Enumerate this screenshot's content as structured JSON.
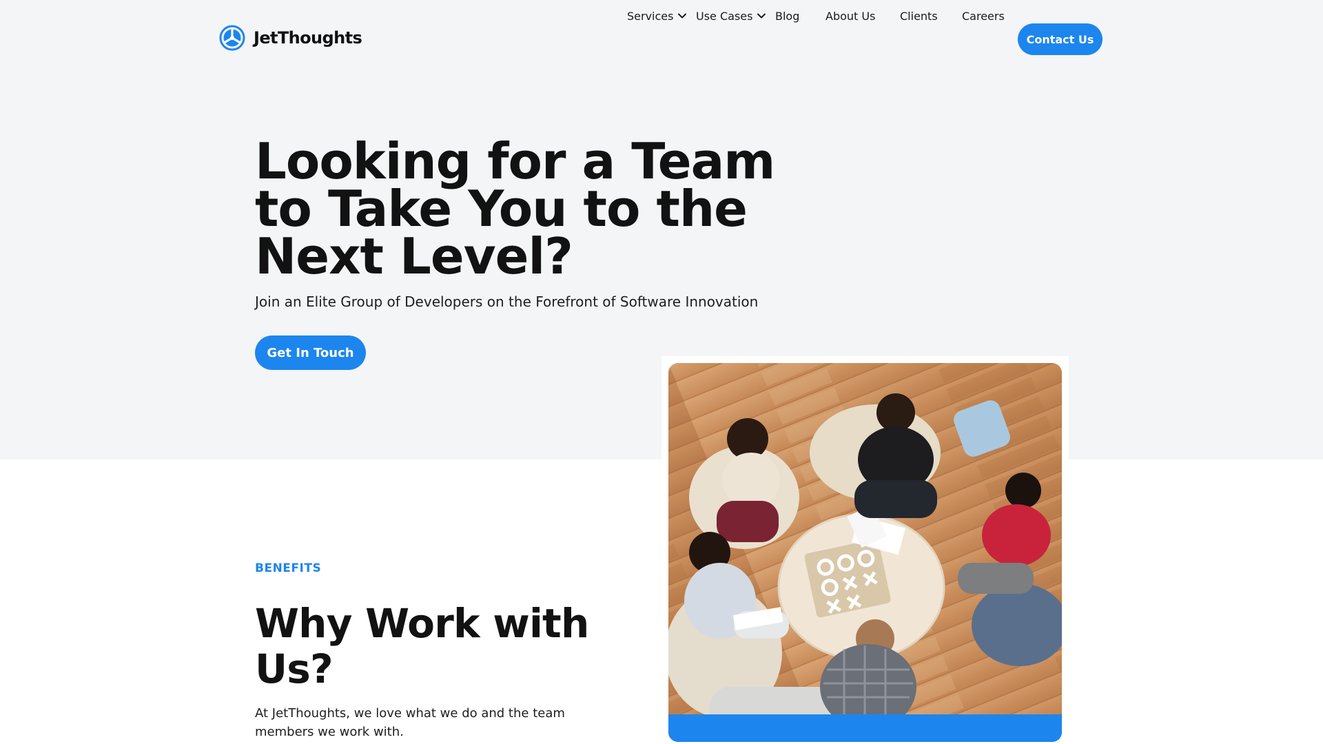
{
  "header": {
    "logo_text": "JetThoughts",
    "nav": [
      {
        "label": "Services",
        "has_dropdown": true
      },
      {
        "label": "Use Cases",
        "has_dropdown": true
      },
      {
        "label": "Blog",
        "has_dropdown": false
      },
      {
        "label": "About Us",
        "has_dropdown": false
      },
      {
        "label": "Clients",
        "has_dropdown": false
      },
      {
        "label": "Careers",
        "has_dropdown": false
      }
    ],
    "contact_label": "Contact Us"
  },
  "hero": {
    "title": "Looking for a Team to Take You to the Next Level?",
    "subtitle": "Join an Elite Group of Developers on the Forefront of Software Innovation",
    "cta_label": "Get In Touch"
  },
  "benefits": {
    "eyebrow": "BENEFITS",
    "title": "Why Work with Us?",
    "body": "At JetThoughts, we love what we do and the team members we work with."
  },
  "colors": {
    "accent": "#1c86ee",
    "hero_background": "#f4f5f7",
    "text": "#121212"
  },
  "icons": {
    "logo": "jetthoughts-logo-icon",
    "dropdown": "chevron-down-icon"
  }
}
